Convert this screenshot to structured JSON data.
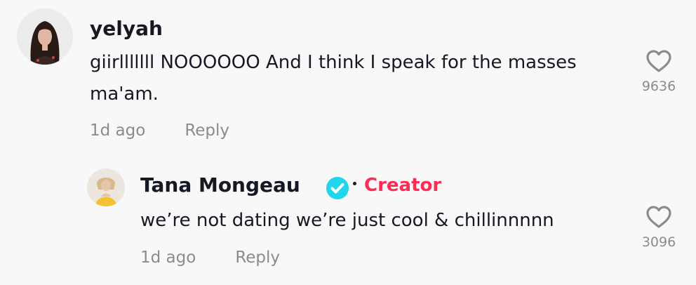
{
  "colors": {
    "background": "#f8f8f8",
    "text": "#161823",
    "muted": "#8a8b91",
    "creator": "#fe2c55",
    "verified": "#20d5ec"
  },
  "comments": [
    {
      "username": "yelyah",
      "text": "giirlllllll NOOOOOO And I think I speak for the masses ma'am.",
      "time": "1d ago",
      "reply_label": "Reply",
      "likes": "9636",
      "avatar_icon": "user-avatar-icon",
      "like_icon": "heart-outline-icon"
    },
    {
      "username": "Tana Mongeau",
      "verified_icon": "verified-check-icon",
      "badge": "Creator",
      "text": "we’re not dating we’re just cool & chillinnnnn",
      "time": "1d ago",
      "reply_label": "Reply",
      "likes": "3096",
      "avatar_icon": "user-avatar-icon",
      "like_icon": "heart-outline-icon"
    }
  ]
}
